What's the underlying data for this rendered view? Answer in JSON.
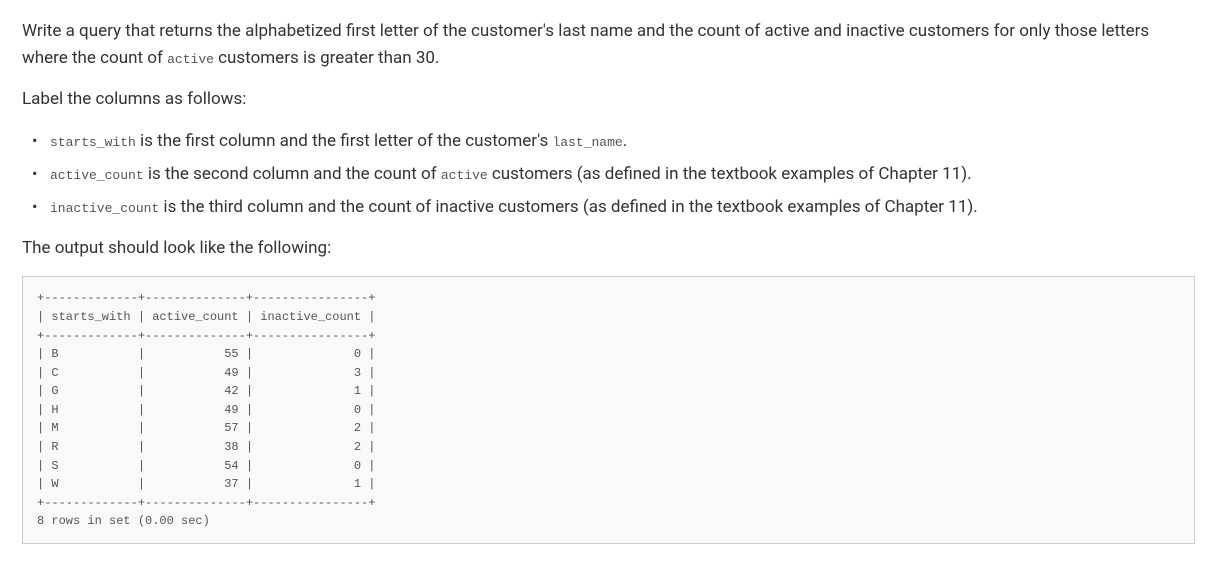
{
  "intro": "Write a query that returns the alphabetized first letter of the customer's last name and the count of active and inactive customers for only those letters where the count of ",
  "intro_code": "active",
  "intro_tail": " customers is greater than 30.",
  "label_heading": "Label the columns as follows:",
  "bullets": [
    {
      "code1": "starts_with",
      "t1": " is the first column and the first letter of the customer's ",
      "code2": "last_name",
      "t2": "."
    },
    {
      "code1": "active_count",
      "t1": " is the second column and the count of ",
      "code2": "active",
      "t2": " customers (as defined in the textbook examples of Chapter 11)."
    },
    {
      "code1": "inactive_count",
      "t1": " is the third column and the count of inactive customers (as defined in the textbook examples of Chapter 11).",
      "code2": "",
      "t2": ""
    }
  ],
  "output_heading": "The output should look like the following:",
  "chart_data": {
    "type": "table",
    "columns": [
      "starts_with",
      "active_count",
      "inactive_count"
    ],
    "rows": [
      {
        "starts_with": "B",
        "active_count": 55,
        "inactive_count": 0
      },
      {
        "starts_with": "C",
        "active_count": 49,
        "inactive_count": 3
      },
      {
        "starts_with": "G",
        "active_count": 42,
        "inactive_count": 1
      },
      {
        "starts_with": "H",
        "active_count": 49,
        "inactive_count": 0
      },
      {
        "starts_with": "M",
        "active_count": 57,
        "inactive_count": 2
      },
      {
        "starts_with": "R",
        "active_count": 38,
        "inactive_count": 2
      },
      {
        "starts_with": "S",
        "active_count": 54,
        "inactive_count": 0
      },
      {
        "starts_with": "W",
        "active_count": 37,
        "inactive_count": 1
      }
    ],
    "footer": "8 rows in set (0.00 sec)"
  }
}
